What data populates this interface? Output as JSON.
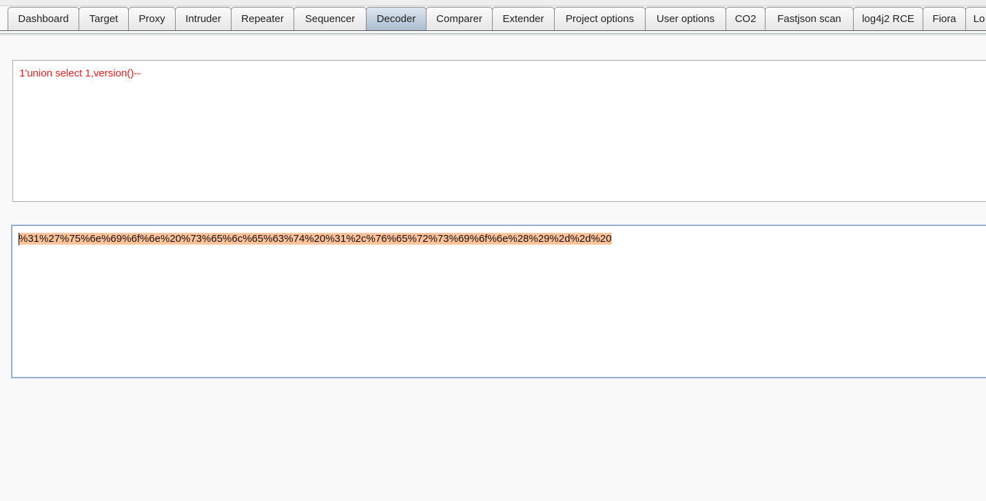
{
  "tabs": [
    {
      "label": "Dashboard",
      "active": false
    },
    {
      "label": "Target",
      "active": false
    },
    {
      "label": "Proxy",
      "active": false
    },
    {
      "label": "Intruder",
      "active": false
    },
    {
      "label": "Repeater",
      "active": false
    },
    {
      "label": "Sequencer",
      "active": false
    },
    {
      "label": "Decoder",
      "active": true
    },
    {
      "label": "Comparer",
      "active": false
    },
    {
      "label": "Extender",
      "active": false
    },
    {
      "label": "Project options",
      "active": false
    },
    {
      "label": "User options",
      "active": false
    },
    {
      "label": "CO2",
      "active": false
    },
    {
      "label": "Fastjson scan",
      "active": false
    },
    {
      "label": "log4j2 RCE",
      "active": false
    },
    {
      "label": "Fiora",
      "active": false
    },
    {
      "label": "Lo",
      "active": false
    }
  ],
  "decoder": {
    "input_text": "1'union select 1,version()--",
    "output_text": "%31%27%75%6e%69%6f%6e%20%73%65%6c%65%63%74%20%31%2c%76%65%72%73%69%6f%6e%28%29%2d%2d%20",
    "input_color": "#ff1a1a",
    "selection_color": "#ffc299"
  }
}
